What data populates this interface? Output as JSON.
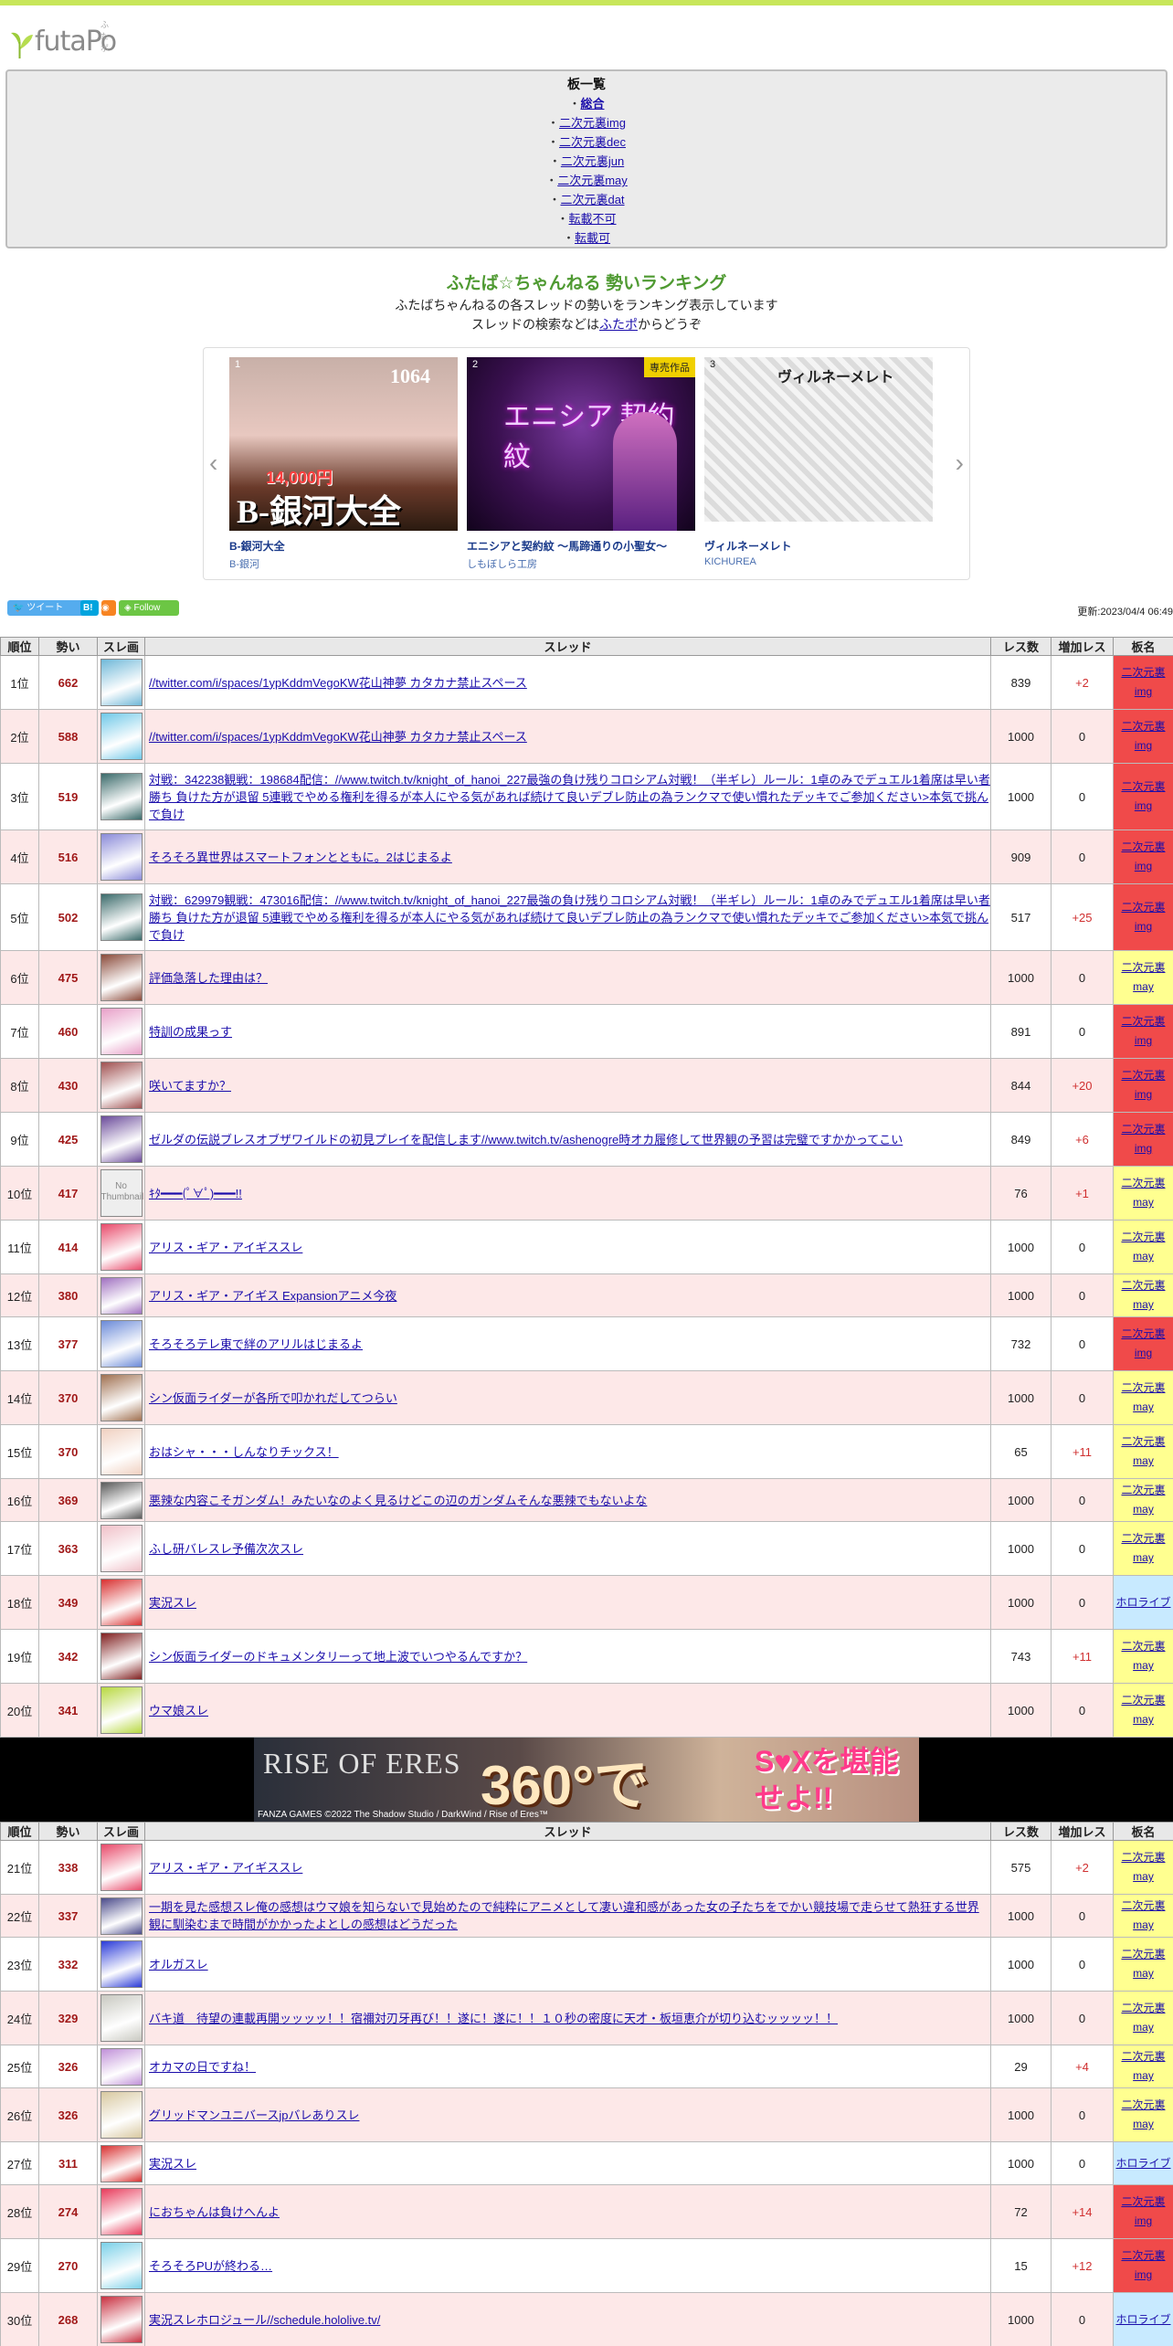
{
  "site": {
    "logo_text": "futaPo",
    "logo_ruby": "ふたポ"
  },
  "boards": {
    "heading": "板一覧",
    "bullet": "・",
    "items": [
      "総合",
      "二次元裏img",
      "二次元裏dec",
      "二次元裏jun",
      "二次元裏may",
      "二次元裏dat",
      "転載不可",
      "転載可"
    ]
  },
  "intro": {
    "title": "ふたば☆ちゃんねる 勢いランキング",
    "line1": "ふたばちゃんねるの各スレッドの勢いをランキング表示しています",
    "line2_pre": "スレッドの検索などは",
    "line2_link": "ふたポ",
    "line2_post": "からどうぞ"
  },
  "carousel": {
    "items": [
      {
        "num": "1",
        "name": "B-銀河大全",
        "maker": "B-銀河",
        "img_text": "B-銀河大全",
        "price_text": "14,000円",
        "count_text": "1064"
      },
      {
        "num": "2",
        "name": "エニシアと契約紋 ～馬蹄通りの小聖女～",
        "maker": "しもぼしら工房",
        "exclusive": "専売作品",
        "img_text": "エニシア 契約紋"
      },
      {
        "num": "3",
        "name": "ヴィルネーメレト",
        "maker": "KICHUREA",
        "img_text": "ヴィルネーメレト"
      }
    ]
  },
  "social": {
    "tweet": "ツイート",
    "hatena": "B!",
    "follow": "Follow",
    "updated": "更新:2023/04/4 06:49"
  },
  "table": {
    "headers": [
      "順位",
      "勢い",
      "スレ画",
      "スレッド",
      "レス数",
      "増加レス",
      "板名"
    ]
  },
  "rows1": [
    {
      "rank": "1位",
      "score": "662",
      "title": "//twitter.com/i/spaces/1ypKddmVegoKW花山神夢 カタカナ禁止スペース",
      "res": "839",
      "inc": "+2",
      "board": "二次元裏img",
      "bc": "red",
      "th": "#6fb8d8"
    },
    {
      "rank": "2位",
      "score": "588",
      "title": "//twitter.com/i/spaces/1ypKddmVegoKW花山神夢 カタカナ禁止スペース",
      "res": "1000",
      "inc": "0",
      "board": "二次元裏img",
      "bc": "red",
      "th": "#6fc8e8"
    },
    {
      "rank": "3位",
      "score": "519",
      "title": "対戦：342238観戦：198684配信：//www.twitch.tv/knight_of_hanoi_227最強の負け残りコロシアム対戦！（半ギレ）ルール：1卓のみでデュエル1着席は早い者勝ち 負けた方が退留 5連戦でやめる権利を得るが本人にやる気があれば続けて良いデブレ防止の為ランクマで使い慣れたデッキでご参加ください>本気で挑んで負け",
      "res": "1000",
      "inc": "0",
      "board": "二次元裏img",
      "bc": "red",
      "th": "#3a6a6a"
    },
    {
      "rank": "4位",
      "score": "516",
      "title": "そろそろ異世界はスマートフォンとともに。2はじまるよ",
      "res": "909",
      "inc": "0",
      "board": "二次元裏img",
      "bc": "red",
      "th": "#8a8ad8"
    },
    {
      "rank": "5位",
      "score": "502",
      "title": "対戦：629979観戦：473016配信：//www.twitch.tv/knight_of_hanoi_227最強の負け残りコロシアム対戦！（半ギレ）ルール：1卓のみでデュエル1着席は早い者勝ち 負けた方が退留 5連戦でやめる権利を得るが本人にやる気があれば続けて良いデブレ防止の為ランクマで使い慣れたデッキでご参加ください>本気で挑んで負け",
      "res": "517",
      "inc": "+25",
      "board": "二次元裏img",
      "bc": "red",
      "th": "#3a6a6a"
    },
    {
      "rank": "6位",
      "score": "475",
      "title": "評価急落した理由は？",
      "res": "1000",
      "inc": "0",
      "board": "二次元裏may",
      "bc": "yel",
      "th": "#8a4a3a"
    },
    {
      "rank": "7位",
      "score": "460",
      "title": "特訓の成果っす",
      "res": "891",
      "inc": "0",
      "board": "二次元裏img",
      "bc": "red",
      "th": "#e8a0c8"
    },
    {
      "rank": "8位",
      "score": "430",
      "title": "咲いてますか？",
      "res": "844",
      "inc": "+20",
      "board": "二次元裏img",
      "bc": "red",
      "th": "#a05050"
    },
    {
      "rank": "9位",
      "score": "425",
      "title": "ゼルダの伝説ブレスオブザワイルドの初見プレイを配信します//www.twitch.tv/ashenogre時オカ履修して世界観の予習は完璧ですかかってこい",
      "res": "849",
      "inc": "+6",
      "board": "二次元裏img",
      "bc": "red",
      "th": "#6a4a9a"
    },
    {
      "rank": "10位",
      "score": "417",
      "title": "ｷﾀ━━━(ﾟ∀ﾟ)━━━!!",
      "res": "76",
      "inc": "+1",
      "board": "二次元裏may",
      "bc": "yel",
      "th": "#eeeeee",
      "nothumb": "No Thumbnail"
    },
    {
      "rank": "11位",
      "score": "414",
      "title": "アリス・ギア・アイギススレ",
      "res": "1000",
      "inc": "0",
      "board": "二次元裏may",
      "bc": "yel",
      "th": "#e84a6a"
    },
    {
      "rank": "12位",
      "score": "380",
      "title": "アリス・ギア・アイギス Expansionアニメ今夜",
      "res": "1000",
      "inc": "0",
      "board": "二次元裏may",
      "bc": "yel",
      "th": "#a070c0"
    },
    {
      "rank": "13位",
      "score": "377",
      "title": "そろそろテレ東で絆のアリルはじまるよ",
      "res": "732",
      "inc": "0",
      "board": "二次元裏img",
      "bc": "red",
      "th": "#6a8ad8"
    },
    {
      "rank": "14位",
      "score": "370",
      "title": "シン仮面ライダーが各所で叩かれだしてつらい",
      "res": "1000",
      "inc": "0",
      "board": "二次元裏may",
      "bc": "yel",
      "th": "#a07050"
    },
    {
      "rank": "15位",
      "score": "370",
      "title": "おはシャ・・・しんなりチックス！",
      "res": "65",
      "inc": "+11",
      "board": "二次元裏may",
      "bc": "yel",
      "th": "#f0d0c0"
    },
    {
      "rank": "16位",
      "score": "369",
      "title": "悪辣な内容こそガンダム！みたいなのよく見るけどこの辺のガンダムそんな悪辣でもないよな",
      "res": "1000",
      "inc": "0",
      "board": "二次元裏may",
      "bc": "yel",
      "th": "#5a5a5a"
    },
    {
      "rank": "17位",
      "score": "363",
      "title": "ふし研バレスレ予備次次スレ",
      "res": "1000",
      "inc": "0",
      "board": "二次元裏may",
      "bc": "yel",
      "th": "#f0c0c8"
    },
    {
      "rank": "18位",
      "score": "349",
      "title": "実況スレ",
      "res": "1000",
      "inc": "0",
      "board": "ホロライブ",
      "bc": "blu",
      "th": "#d83030"
    },
    {
      "rank": "19位",
      "score": "342",
      "title": "シン仮面ライダーのドキュメンタリーって地上波でいつやるんですか？",
      "res": "743",
      "inc": "+11",
      "board": "二次元裏may",
      "bc": "yel",
      "th": "#802020"
    },
    {
      "rank": "20位",
      "score": "341",
      "title": "ウマ娘スレ",
      "res": "1000",
      "inc": "0",
      "board": "二次元裏may",
      "bc": "yel",
      "th": "#b8d840"
    }
  ],
  "banner": {
    "title": "RISE OF ERES",
    "big": "360°で",
    "tag": "S♥Xを堪能せよ!!",
    "copy": "FANZA GAMES ©2022 The Shadow Studio / DarkWind / Rise of Eres™"
  },
  "rows2": [
    {
      "rank": "21位",
      "score": "338",
      "title": "アリス・ギア・アイギススレ",
      "res": "575",
      "inc": "+2",
      "board": "二次元裏may",
      "bc": "yel",
      "th": "#e84a6a"
    },
    {
      "rank": "22位",
      "score": "337",
      "title": "一期を見た感想スレ俺の感想はウマ娘を知らないで見始めたので純粋にアニメとして凄い違和感があった女の子たちをでかい競技場で走らせて熱狂する世界観に馴染むまで時間がかかったよとしの感想はどうだった",
      "res": "1000",
      "inc": "0",
      "board": "二次元裏may",
      "bc": "yel",
      "th": "#4a4a8a"
    },
    {
      "rank": "23位",
      "score": "332",
      "title": "オルガスレ",
      "res": "1000",
      "inc": "0",
      "board": "二次元裏may",
      "bc": "yel",
      "th": "#2a3ad8"
    },
    {
      "rank": "24位",
      "score": "329",
      "title": "バキ道　待望の連載再開ッッッッ！！宿禰対刃牙再び！！遂に！遂に！！１０秒の密度に天才・板垣恵介が切り込むッッッッ！！",
      "res": "1000",
      "inc": "0",
      "board": "二次元裏may",
      "bc": "yel",
      "th": "#c8c8c0"
    },
    {
      "rank": "25位",
      "score": "326",
      "title": "オカマの日ですね！",
      "res": "29",
      "inc": "+4",
      "board": "二次元裏may",
      "bc": "yel",
      "th": "#c090d8"
    },
    {
      "rank": "26位",
      "score": "326",
      "title": "グリッドマンユニバースjpバレありスレ",
      "res": "1000",
      "inc": "0",
      "board": "二次元裏may",
      "bc": "yel",
      "th": "#d8c8a0"
    },
    {
      "rank": "27位",
      "score": "311",
      "title": "実況スレ",
      "res": "1000",
      "inc": "0",
      "board": "ホロライブ",
      "bc": "blu",
      "th": "#d83030"
    },
    {
      "rank": "28位",
      "score": "274",
      "title": "におちゃんは負けへんよ",
      "res": "72",
      "inc": "+14",
      "board": "二次元裏img",
      "bc": "red",
      "th": "#e83a5a"
    },
    {
      "rank": "29位",
      "score": "270",
      "title": "そろそろPUが終わる…",
      "res": "15",
      "inc": "+12",
      "board": "二次元裏img",
      "bc": "red",
      "th": "#7ad0e8"
    },
    {
      "rank": "30位",
      "score": "268",
      "title": "実況スレホロジュール//schedule.hololive.tv/",
      "res": "1000",
      "inc": "0",
      "board": "ホロライブ",
      "bc": "blu",
      "th": "#c83040"
    }
  ]
}
